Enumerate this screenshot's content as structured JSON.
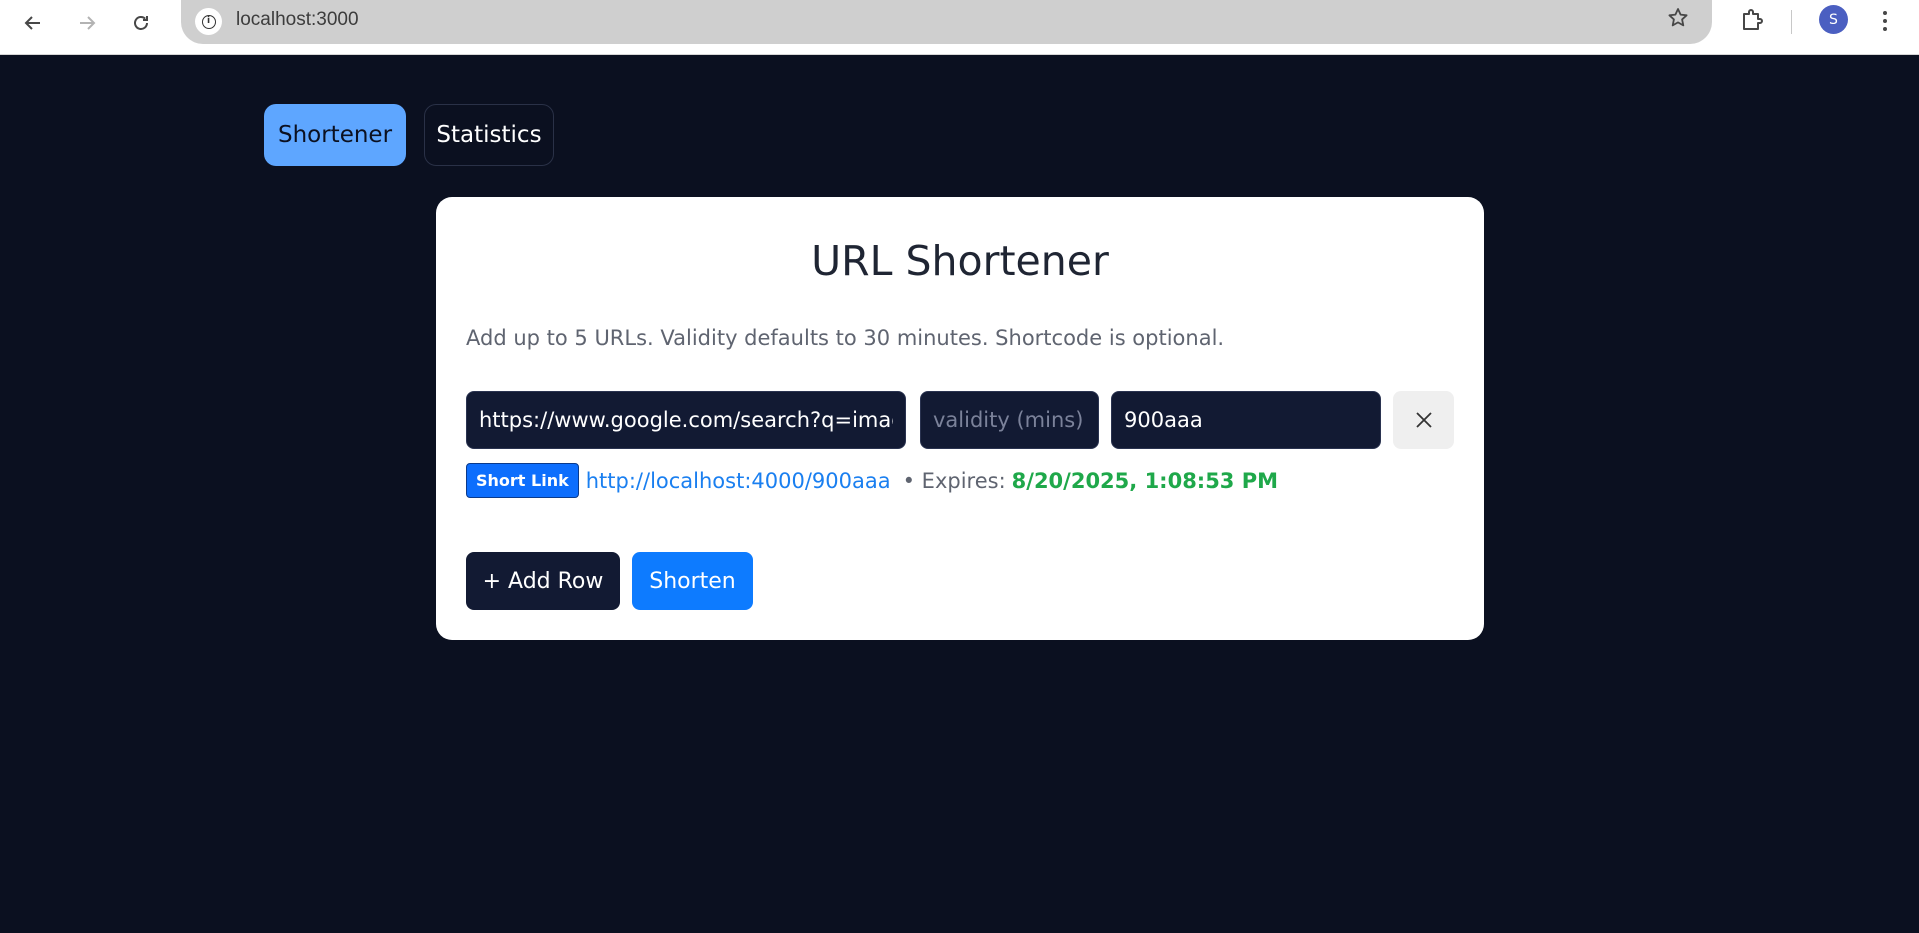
{
  "browser": {
    "url": "localhost:3000",
    "profile_initial": "S",
    "icons": {
      "back": "back-arrow-icon",
      "forward": "forward-arrow-icon",
      "reload": "reload-icon",
      "site_info": "info-icon",
      "bookmark": "star-icon",
      "extensions": "puzzle-icon",
      "menu": "kebab-menu-icon"
    }
  },
  "tabs": [
    {
      "label": "Shortener",
      "active": true
    },
    {
      "label": "Statistics",
      "active": false
    }
  ],
  "card": {
    "title": "URL Shortener",
    "subtitle": "Add up to 5 URLs. Validity defaults to 30 minutes. Shortcode is optional."
  },
  "row": {
    "url_value": "https://www.google.com/search?q=image",
    "validity_placeholder": "validity (mins)",
    "validity_value": "",
    "shortcode_value": "900aaa",
    "remove_icon": "close-icon"
  },
  "result": {
    "badge": "Short Link",
    "link": "http://localhost:4000/900aaa",
    "expires_label": "• Expires:",
    "expires_value": "8/20/2025, 1:08:53 PM"
  },
  "actions": {
    "add_row": "+ Add Row",
    "shorten": "Shorten"
  },
  "colors": {
    "page_bg": "#0b1020",
    "active_tab": "#5ea6ff",
    "primary": "#0d7bff",
    "success": "#1fa84a",
    "link": "#1a7ff0"
  }
}
